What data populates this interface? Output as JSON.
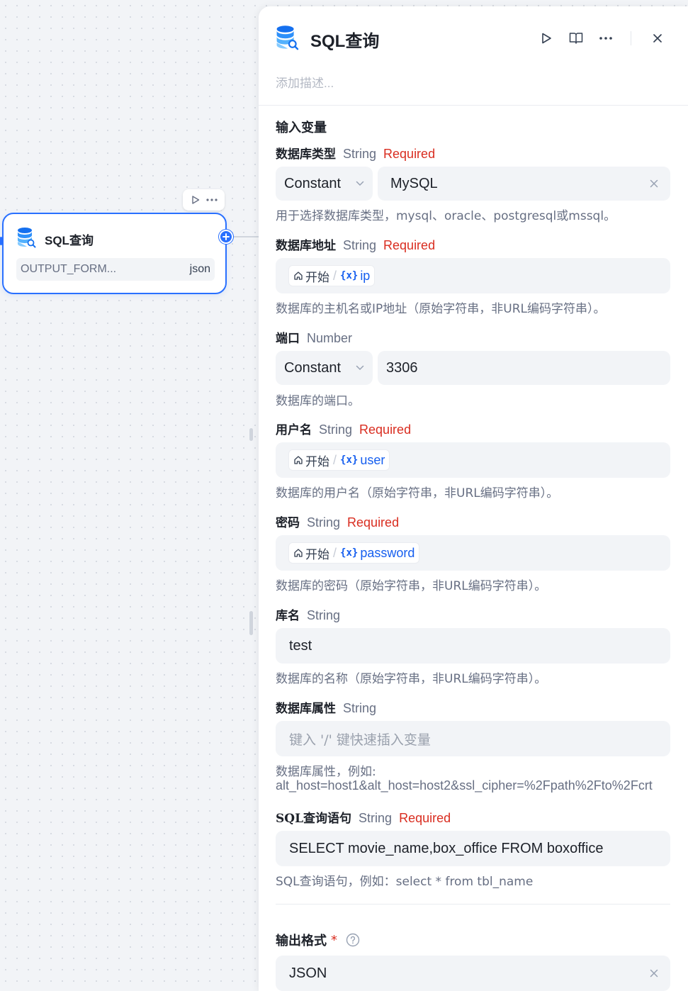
{
  "node": {
    "title": "SQL查询",
    "output_key": "OUTPUT_FORM...",
    "output_type": "json",
    "toolbar": {
      "run_icon": "play-icon",
      "more_icon": "more-icon"
    }
  },
  "panel": {
    "title": "SQL查询",
    "description_placeholder": "添加描述...",
    "input_section_title": "输入变量",
    "fields": {
      "db_type": {
        "name": "数据库类型",
        "type": "String",
        "required": "Required",
        "mode": "Constant",
        "value": "MySQL",
        "help": "用于选择数据库类型，mysql、oracle、postgresql或mssql。"
      },
      "db_host": {
        "name": "数据库地址",
        "type": "String",
        "required": "Required",
        "ref_node": "开始",
        "ref_var": "ip",
        "help": "数据库的主机名或IP地址（原始字符串，非URL编码字符串）。"
      },
      "port": {
        "name": "端口",
        "type": "Number",
        "mode": "Constant",
        "value": "3306",
        "help": "数据库的端口。"
      },
      "username": {
        "name": "用户名",
        "type": "String",
        "required": "Required",
        "ref_node": "开始",
        "ref_var": "user",
        "help": "数据库的用户名（原始字符串，非URL编码字符串）。"
      },
      "password": {
        "name": "密码",
        "type": "String",
        "required": "Required",
        "ref_node": "开始",
        "ref_var": "password",
        "help": "数据库的密码（原始字符串，非URL编码字符串）。"
      },
      "db_name": {
        "name": "库名",
        "type": "String",
        "value": "test",
        "help": "数据库的名称（原始字符串，非URL编码字符串）。"
      },
      "db_props": {
        "name": "数据库属性",
        "type": "String",
        "placeholder": "键入 '/' 键快速插入变量",
        "help_line1": "数据库属性，例如:",
        "help_line2": "alt_host=host1&alt_host=host2&ssl_cipher=%2Fpath%2Fto%2Fcrt"
      },
      "sql": {
        "name": "SQL查询语句",
        "type": "String",
        "required": "Required",
        "value": "SELECT movie_name,box_office FROM boxoffice",
        "help": "SQL查询语句，例如：select * from tbl_name"
      }
    },
    "output_format": {
      "label": "输出格式",
      "asterisk": "*",
      "value": "JSON"
    }
  },
  "colors": {
    "accent": "#2970ff",
    "required": "#d92d20",
    "variable": "#155eef"
  }
}
